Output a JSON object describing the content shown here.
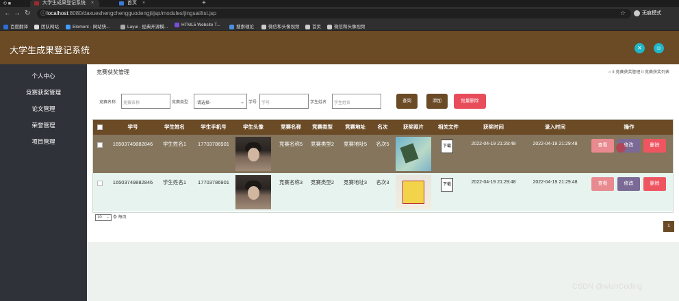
{
  "browser": {
    "tabs": [
      {
        "label": "大学生成果登记系统",
        "active": true
      },
      {
        "label": "首页",
        "active": false
      }
    ],
    "new_tab": "+",
    "url_host": "localhost",
    "url_path": ":8080/daxueshengchengguodengji/jsp/modules/jingsai/list.jsp",
    "profile_label": "无痕模式",
    "bookmarks": [
      "百度翻译",
      "团队网站",
      "Element - 网站快...",
      "Layui - 经典开源模...",
      "HTML5 Website T...",
      "搜索理论",
      "微信和头像视频",
      "首页",
      "微信和头像视频"
    ]
  },
  "app": {
    "title": "大学生成果登记系统",
    "header_buttons": [
      "fullscreen-icon",
      "user-icon"
    ]
  },
  "sidebar": {
    "items": [
      "个人中心",
      "竞赛获奖管理",
      "论文管理",
      "荣誉管理",
      "项目管理"
    ]
  },
  "page": {
    "title": "竞赛获奖管理",
    "breadcrumb": "⌂ II 竞赛获奖管理 II 竞赛获奖列表"
  },
  "filters": {
    "name_label": "竞赛名称",
    "name_placeholder": "竞赛名称",
    "type_label": "竞赛类型",
    "type_selected": "-请选择-",
    "xuehao_label": "学号",
    "xuehao_placeholder": "学号",
    "student_label": "学生姓名",
    "student_placeholder": "学生姓名",
    "search_btn": "查询",
    "add_btn": "添加",
    "batch_delete_btn": "批量删除"
  },
  "table": {
    "headers": [
      "学号",
      "学生姓名",
      "学生手机号",
      "学生头像",
      "竞赛名称",
      "竞赛类型",
      "竞赛地址",
      "名次",
      "获奖照片",
      "相关文件",
      "获奖时间",
      "录入时间",
      "操作"
    ],
    "rows": [
      {
        "xuehao": "16503749882846",
        "name": "学生姓名1",
        "phone": "17703786901",
        "comp_name": "竞赛名称5",
        "comp_type": "竞赛类型2",
        "comp_addr": "竞赛地址5",
        "rank": "名次5",
        "file": "下载",
        "award_time": "2022-04-19 21:29:48",
        "entry_time": "2022-04-19 21:29:48"
      },
      {
        "xuehao": "16503749882846",
        "name": "学生姓名1",
        "phone": "17703786901",
        "comp_name": "竞赛名称3",
        "comp_type": "竞赛类型2",
        "comp_addr": "竞赛地址3",
        "rank": "名次3",
        "file": "下载",
        "award_time": "2022-04-19 21:29:48",
        "entry_time": "2022-04-19 21:29:48"
      }
    ],
    "actions": {
      "view": "查看",
      "edit": "修改",
      "delete": "删除"
    }
  },
  "pager": {
    "page_size": "10",
    "per_page_label": "条 每页",
    "current_page": "1"
  },
  "watermark": "CSDN @wishCoding",
  "colors": {
    "brand": "#6b4a26",
    "accent": "#1fb7c8",
    "danger": "#ee5560"
  }
}
